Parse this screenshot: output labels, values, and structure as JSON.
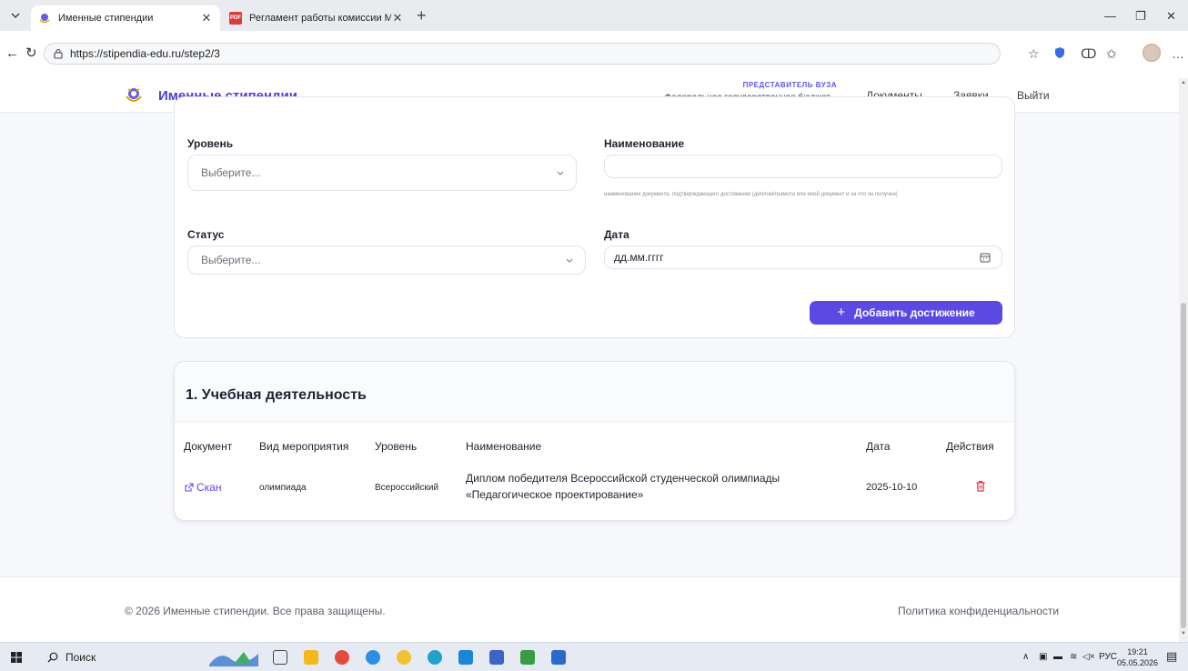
{
  "browser": {
    "tabs": [
      {
        "title": "Именные стипендии",
        "active": true
      },
      {
        "title": "Регламент работы комиссии Ми",
        "active": false
      }
    ],
    "pdf_badge": "PDF",
    "url": "https://stipendia-edu.ru/step2/3"
  },
  "site": {
    "brand": "Именные стипендии",
    "rep_label": "ПРЕДСТАВИТЕЛЬ ВУЗА",
    "rep_org": "Федеральное государственное бюджет...",
    "nav": [
      "Документы",
      "Заявки",
      "Выйти"
    ]
  },
  "form": {
    "level_label": "Уровень",
    "level_placeholder": "Выберите...",
    "name_label": "Наименование",
    "name_hint": "наименование документа, подтверждающего достижение (диплом/грамота или иной документ и за что он получен)",
    "status_label": "Статус",
    "status_placeholder": "Выберите...",
    "date_label": "Дата",
    "date_placeholder": "дд.мм.гггг",
    "add_button": "Добавить достижение"
  },
  "results": {
    "title": "1. Учебная деятельность",
    "headers": [
      "Документ",
      "Вид мероприятия",
      "Уровень",
      "Наименование",
      "Дата",
      "Действия"
    ],
    "rows": [
      {
        "document": "Скан",
        "event_type": "олимпиада",
        "level": "Всероссийский",
        "name_line1": "Диплом победителя Всероссийской студенческой олимпиады",
        "name_line2": "«Педагогическое проектирование»",
        "date": "2025-10-10"
      }
    ]
  },
  "footer": {
    "copyright": "© 2026 Именные стипендии. Все права защищены.",
    "privacy": "Политика конфиденциальности"
  },
  "taskbar": {
    "search": "Поиск",
    "lang": "РУС",
    "time": "19:21",
    "date": "05.05.2026"
  },
  "colors": {
    "accent": "#5a4ae3",
    "brand": "#4b3fd6",
    "danger": "#e0323c"
  }
}
